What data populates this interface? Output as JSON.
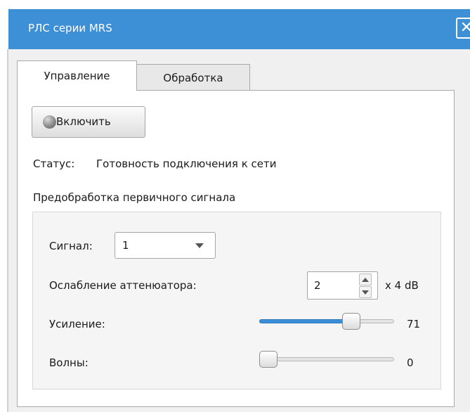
{
  "window": {
    "title": "РЛС серии MRS",
    "close_glyph": "✕"
  },
  "tabs": [
    {
      "label": "Управление",
      "active": true
    },
    {
      "label": "Обработка",
      "active": false
    }
  ],
  "power_button": {
    "label": "Включить",
    "icon": "status-led-icon",
    "led_color": "#8a8a8a"
  },
  "status": {
    "label": "Статус:",
    "value": "Готовность подключения к сети"
  },
  "preprocessing": {
    "title": "Предобработка первичного сигнала",
    "signal": {
      "label": "Сигнал:",
      "value": "1"
    },
    "attenuator": {
      "label": "Ослабление аттенюатора:",
      "value": "2",
      "unit": "x 4 dB"
    },
    "gain": {
      "label": "Усиление:",
      "value": 71,
      "max": 100
    },
    "waves": {
      "label": "Волны:",
      "value": 0,
      "max": 100
    }
  },
  "colors": {
    "titlebar": "#3d8fd6",
    "slider_fill": "#3b8fd8",
    "window_bg": "#f0f0f0"
  }
}
